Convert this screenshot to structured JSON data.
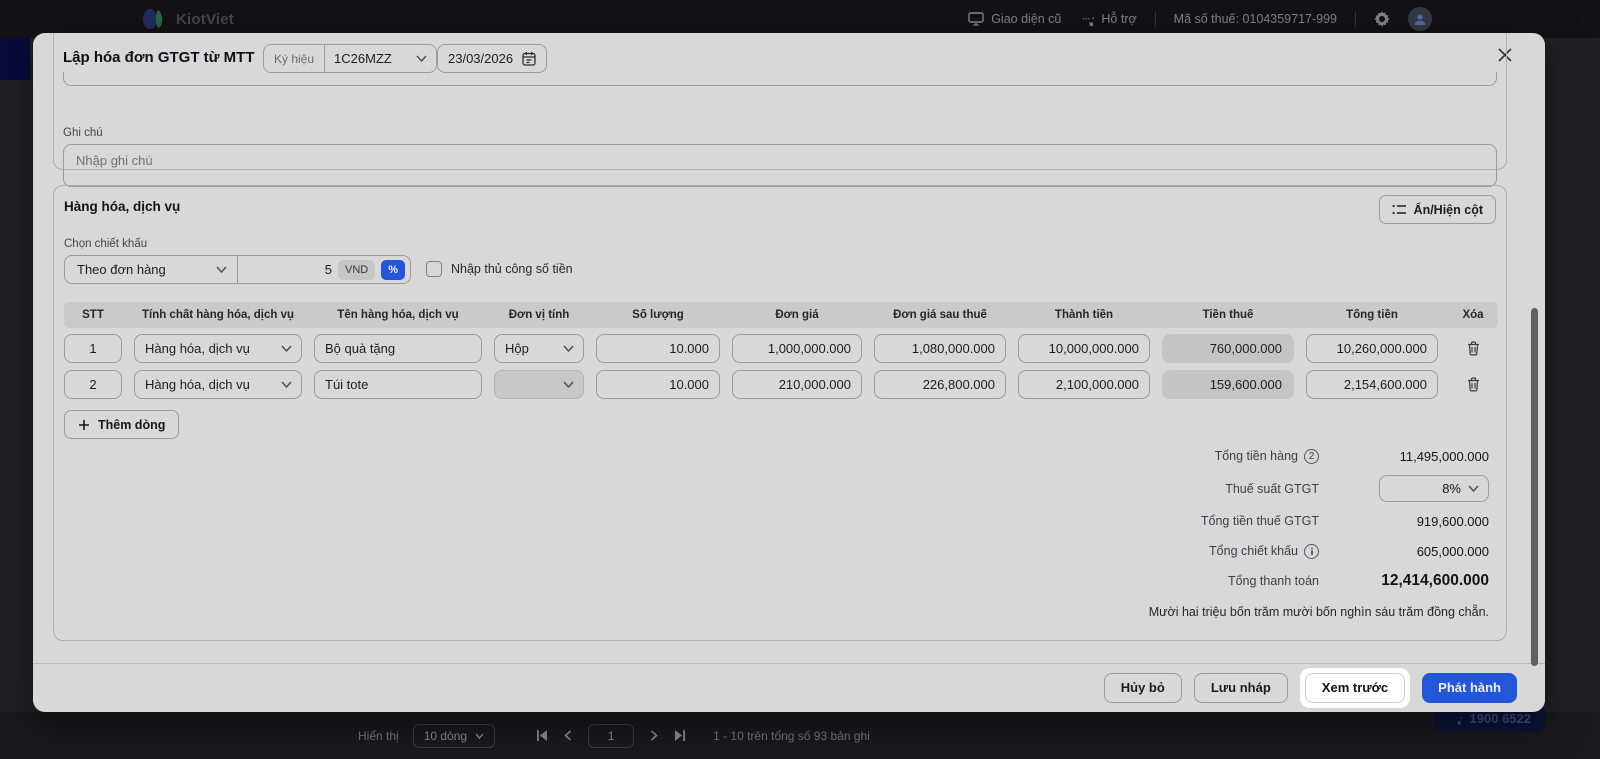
{
  "header": {
    "brand": "KiotViet",
    "old_ui": "Giao diện cũ",
    "support": "Hỗ trợ",
    "tax_code": "Mã số thuế: 0104359717-999"
  },
  "modal": {
    "title": "Lập hóa đơn GTGT từ MTT",
    "symbol_label": "Ký hiệu",
    "symbol_value": "1C26MZZ",
    "date": "23/03/2026",
    "note_label": "Ghi chú",
    "note_placeholder": "Nhập ghi chú",
    "items_section": {
      "title": "Hàng hóa, dịch vụ",
      "toggle_columns": "Ẩn/Hiện cột",
      "discount_label": "Chọn chiết khấu",
      "discount_type": "Theo đơn hàng",
      "discount_value": "5",
      "unit_vnd": "VND",
      "unit_percent": "%",
      "manual_checkbox": "Nhập thủ công số tiền",
      "add_row": "Thêm dòng",
      "table": {
        "headers": [
          "STT",
          "Tính chất hàng hóa, dịch vụ",
          "Tên hàng hóa, dịch vụ",
          "Đơn vị tính",
          "Số lượng",
          "Đơn giá",
          "Đơn giá sau thuế",
          "Thành tiền",
          "Tiền thuế",
          "Tổng tiền",
          "Xóa"
        ],
        "rows": [
          {
            "stt": "1",
            "type": "Hàng hóa, dịch vụ",
            "name": "Bộ quà tặng",
            "unit": "Hộp",
            "qty": "10.000",
            "price": "1,000,000.000",
            "price_after_tax": "1,080,000.000",
            "amount": "10,000,000.000",
            "tax": "760,000.000",
            "total": "10,260,000.000"
          },
          {
            "stt": "2",
            "type": "Hàng hóa, dịch vụ",
            "name": "Túi tote",
            "unit": "",
            "qty": "10.000",
            "price": "210,000.000",
            "price_after_tax": "226,800.000",
            "amount": "2,100,000.000",
            "tax": "159,600.000",
            "total": "2,154,600.000"
          }
        ]
      },
      "totals": {
        "subtotal_label": "Tổng tiền hàng",
        "subtotal_badge": "2",
        "subtotal": "11,495,000.000",
        "vat_rate_label": "Thuế suất GTGT",
        "vat_rate": "8%",
        "vat_total_label": "Tổng tiền thuế GTGT",
        "vat_total": "919,600.000",
        "discount_total_label": "Tổng chiết khấu",
        "discount_total": "605,000.000",
        "grand_total_label": "Tổng thanh toán",
        "grand_total": "12,414,600.000",
        "in_words": "Mười hai triệu bốn trăm mười bốn nghìn sáu trăm đồng chẵn."
      }
    },
    "footer": {
      "cancel": "Hủy bỏ",
      "save_draft": "Lưu nháp",
      "preview": "Xem trước",
      "publish": "Phát hành"
    }
  },
  "pagination": {
    "show_label": "Hiển thị",
    "page_size": "10 dòng",
    "page": "1",
    "summary": "1 - 10 trên tổng số 93 bản ghi"
  },
  "hotline": "1900 6522",
  "colors": {
    "accent": "#2356d9"
  }
}
